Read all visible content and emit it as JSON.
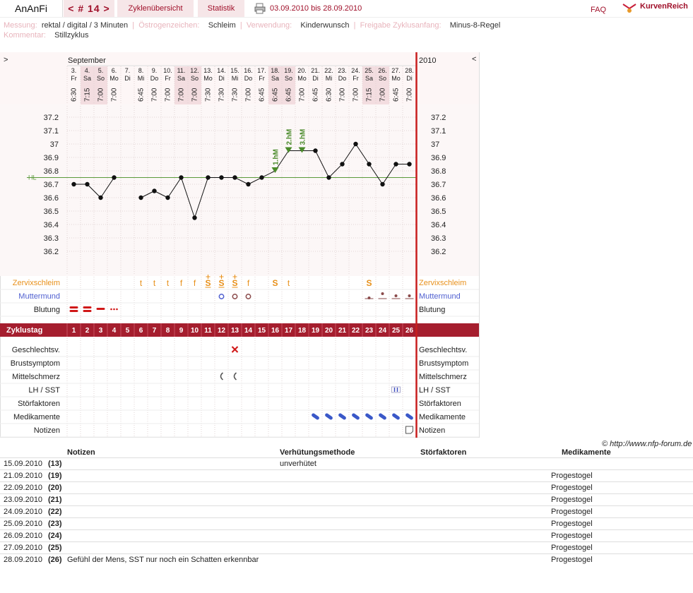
{
  "header": {
    "username": "AnAnFi",
    "cycle_nav": "< # 14 >",
    "overview": "Zyklenübersicht",
    "stats": "Statistik",
    "range": "03.09.2010 bis 28.09.2010",
    "faq": "FAQ",
    "brand": "KurvenReich"
  },
  "info": {
    "messung_label": "Messung:",
    "messung": "rektal / digital / 3 Minuten",
    "oestro_label": "Östrogenzeichen:",
    "oestro": "Schleim",
    "verwendung_label": "Verwendung:",
    "verwendung": "Kinderwunsch",
    "freigabe_label": "Freigabe Zyklusanfang:",
    "freigabe": "Minus-8-Regel",
    "kommentar_label": "Kommentar:",
    "kommentar": "Stillzyklus"
  },
  "chart_data": {
    "type": "line",
    "month": "September",
    "year": "2010",
    "nav_left": ">",
    "nav_right": "<",
    "hl_label": "HL",
    "coverline": 36.75,
    "ylim": [
      36.2,
      37.2
    ],
    "yticks": [
      "37.2",
      "37.1",
      "37",
      "36.9",
      "36.8",
      "36.7",
      "36.6",
      "36.5",
      "36.4",
      "36.3",
      "36.2"
    ],
    "days": [
      {
        "d": "3.",
        "w": "Fr",
        "t": "6:30",
        "temp": 36.7,
        "we": false
      },
      {
        "d": "4.",
        "w": "Sa",
        "t": "7:15",
        "temp": 36.7,
        "we": true
      },
      {
        "d": "5.",
        "w": "So",
        "t": "7:00",
        "temp": 36.6,
        "we": true
      },
      {
        "d": "6.",
        "w": "Mo",
        "t": "7:00",
        "temp": 36.75,
        "we": false
      },
      {
        "d": "7.",
        "w": "Di",
        "t": "",
        "temp": null,
        "we": false
      },
      {
        "d": "8.",
        "w": "Mi",
        "t": "6:45",
        "temp": 36.6,
        "we": false
      },
      {
        "d": "9.",
        "w": "Do",
        "t": "7:00",
        "temp": 36.65,
        "we": false
      },
      {
        "d": "10.",
        "w": "Fr",
        "t": "7:00",
        "temp": 36.6,
        "we": false
      },
      {
        "d": "11.",
        "w": "Sa",
        "t": "7:00",
        "temp": 36.75,
        "we": true
      },
      {
        "d": "12.",
        "w": "So",
        "t": "7:00",
        "temp": 36.45,
        "we": true
      },
      {
        "d": "13.",
        "w": "Mo",
        "t": "7:30",
        "temp": 36.75,
        "we": false
      },
      {
        "d": "14.",
        "w": "Di",
        "t": "7:30",
        "temp": 36.75,
        "we": false
      },
      {
        "d": "15.",
        "w": "Mi",
        "t": "7:30",
        "temp": 36.75,
        "we": false
      },
      {
        "d": "16.",
        "w": "Do",
        "t": "7:00",
        "temp": 36.7,
        "we": false
      },
      {
        "d": "17.",
        "w": "Fr",
        "t": "6:45",
        "temp": 36.75,
        "we": false
      },
      {
        "d": "18.",
        "w": "Sa",
        "t": "6:45",
        "temp": 36.8,
        "we": true
      },
      {
        "d": "19.",
        "w": "So",
        "t": "6:45",
        "temp": 36.95,
        "we": true
      },
      {
        "d": "20.",
        "w": "Mo",
        "t": "7:00",
        "temp": 36.95,
        "we": false
      },
      {
        "d": "21.",
        "w": "Di",
        "t": "6:45",
        "temp": 36.95,
        "we": false
      },
      {
        "d": "22.",
        "w": "Mi",
        "t": "6:30",
        "temp": 36.75,
        "we": false
      },
      {
        "d": "23.",
        "w": "Do",
        "t": "7:00",
        "temp": 36.85,
        "we": false
      },
      {
        "d": "24.",
        "w": "Fr",
        "t": "7:00",
        "temp": 37.0,
        "we": false
      },
      {
        "d": "25.",
        "w": "Sa",
        "t": "7:15",
        "temp": 36.85,
        "we": true
      },
      {
        "d": "26.",
        "w": "So",
        "t": "7:00",
        "temp": 36.7,
        "we": true
      },
      {
        "d": "27.",
        "w": "Mo",
        "t": "6:45",
        "temp": 36.85,
        "we": false
      },
      {
        "d": "28.",
        "w": "Di",
        "t": "7:00",
        "temp": 36.85,
        "we": false
      }
    ],
    "hm_markers": [
      {
        "day_index": 15,
        "label": "1.hM"
      },
      {
        "day_index": 16,
        "label": "2.hM"
      },
      {
        "day_index": 17,
        "label": "3.hM"
      }
    ],
    "rows": {
      "zervix": "Zervixschleim",
      "muttermund": "Muttermund",
      "blutung": "Blutung",
      "zyklustag": "Zyklustag",
      "gv": "Geschlechtsv.",
      "brust": "Brustsymptom",
      "mittel": "Mittelschmerz",
      "lh": "LH / SST",
      "stoer": "Störfaktoren",
      "medi": "Medikamente",
      "notizen": "Notizen"
    },
    "zervix_values": [
      "",
      "",
      "",
      "",
      "",
      "t",
      "t",
      "t",
      "f",
      "f",
      "S+",
      "S+",
      "S+",
      "f",
      "",
      "S",
      "t",
      "",
      "",
      "",
      "",
      "",
      "S",
      "",
      "",
      ""
    ],
    "muttermund_values": [
      "",
      "",
      "",
      "",
      "",
      "",
      "",
      "",
      "",
      "",
      "",
      "o",
      "o",
      "o",
      "",
      "",
      "",
      "",
      "",
      "",
      "",
      "",
      "s",
      "h",
      "m",
      "m"
    ],
    "blutung_values": [
      "2",
      "2",
      "1",
      "0",
      "",
      "",
      "",
      "",
      "",
      "",
      "",
      "",
      "",
      "",
      "",
      "",
      "",
      "",
      "",
      "",
      "",
      "",
      "",
      "",
      "",
      ""
    ],
    "gv_days": [
      12
    ],
    "mittel_days": [
      11,
      12
    ],
    "lh_days": [
      24
    ],
    "medi_days": [
      18,
      19,
      20,
      21,
      22,
      23,
      24,
      25
    ],
    "notiz_days": [
      25
    ],
    "cycle_days": [
      "1",
      "2",
      "3",
      "4",
      "5",
      "6",
      "7",
      "8",
      "9",
      "10",
      "11",
      "12",
      "13",
      "14",
      "15",
      "16",
      "17",
      "18",
      "19",
      "20",
      "21",
      "22",
      "23",
      "24",
      "25",
      "26"
    ]
  },
  "copyright": "© http://www.nfp-forum.de",
  "table": {
    "headers": [
      "Notizen",
      "Verhütungsmethode",
      "Störfaktoren",
      "Medikamente"
    ],
    "rows": [
      {
        "date": "15.09.2010",
        "day": "(13)",
        "note": "",
        "method": "unverhütet",
        "stoer": "",
        "medi": ""
      },
      {
        "date": "21.09.2010",
        "day": "(19)",
        "note": "",
        "method": "",
        "stoer": "",
        "medi": "Progestogel"
      },
      {
        "date": "22.09.2010",
        "day": "(20)",
        "note": "",
        "method": "",
        "stoer": "",
        "medi": "Progestogel"
      },
      {
        "date": "23.09.2010",
        "day": "(21)",
        "note": "",
        "method": "",
        "stoer": "",
        "medi": "Progestogel"
      },
      {
        "date": "24.09.2010",
        "day": "(22)",
        "note": "",
        "method": "",
        "stoer": "",
        "medi": "Progestogel"
      },
      {
        "date": "25.09.2010",
        "day": "(23)",
        "note": "",
        "method": "",
        "stoer": "",
        "medi": "Progestogel"
      },
      {
        "date": "26.09.2010",
        "day": "(24)",
        "note": "",
        "method": "",
        "stoer": "",
        "medi": "Progestogel"
      },
      {
        "date": "27.09.2010",
        "day": "(25)",
        "note": "",
        "method": "",
        "stoer": "",
        "medi": "Progestogel"
      },
      {
        "date": "28.09.2010",
        "day": "(26)",
        "note": "Gefühl der Mens, SST nur noch ein Schatten erkennbar",
        "method": "",
        "stoer": "",
        "medi": "Progestogel"
      }
    ]
  }
}
